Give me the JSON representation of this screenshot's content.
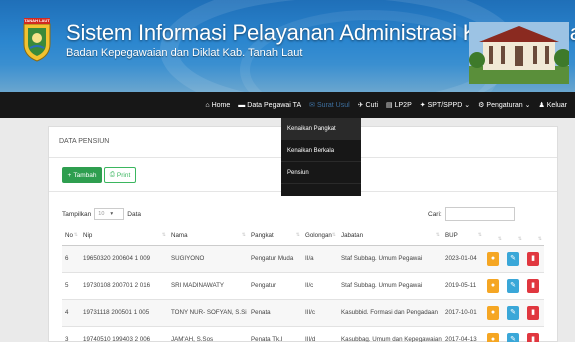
{
  "header": {
    "logo_tag": "TANAH LAUT",
    "title": "Sistem Informasi Pelayanan Administrasi Kepegawaian",
    "subtitle": "Badan Kepegawaian dan Diklat Kab. Tanah Laut"
  },
  "nav": {
    "items": [
      {
        "label": "Home",
        "icon": "home-icon",
        "glyph": "⌂"
      },
      {
        "label": "Data Pegawai TA",
        "icon": "folder-icon",
        "glyph": "▬"
      },
      {
        "label": "Surat Usul",
        "icon": "mail-icon",
        "glyph": "✉"
      },
      {
        "label": "Cuti",
        "icon": "plane-icon",
        "glyph": "✈"
      },
      {
        "label": "LP2P",
        "icon": "document-icon",
        "glyph": "▤"
      },
      {
        "label": "SPT/SPPD",
        "icon": "truck-icon",
        "glyph": "✦"
      },
      {
        "label": "Pengaturan",
        "icon": "gear-icon",
        "glyph": "⚙"
      },
      {
        "label": "Keluar",
        "icon": "user-icon",
        "glyph": "♟"
      }
    ]
  },
  "dropdown": {
    "items": [
      "Kenaikan Pangkat",
      "Kenaikan Berkala",
      "Pensiun"
    ]
  },
  "panel": {
    "title": "DATA PENSIUN",
    "add_label": "Tambah",
    "print_label": "Print",
    "show_label": "Tampilkan",
    "show_value": "10",
    "show_suffix": "Data",
    "search_label": "Cari:"
  },
  "table": {
    "headers": [
      "No",
      "Nip",
      "Nama",
      "Pangkat",
      "Golongan",
      "Jabatan",
      "BUP"
    ],
    "rows": [
      [
        "6",
        "19650320 200604 1 009",
        "SUGIYONO",
        "Pengatur Muda",
        "II/a",
        "Staf Subbag. Umum Pegawai",
        "2023-01-04"
      ],
      [
        "5",
        "19730108 200701 2 016",
        "SRI MADINAWATY",
        "Pengatur",
        "II/c",
        "Staf Subbag. Umum Pegawai",
        "2019-05-11"
      ],
      [
        "4",
        "19731118 200501 1 005",
        "TONY NUR- SOFYAN, S.Si",
        "Penata",
        "III/c",
        "Kasubbid. Formasi dan Pengadaan",
        "2017-10-01"
      ],
      [
        "3",
        "19740510 199403 2 006",
        "JAM'AH, S.Sos",
        "Penata Tk.I",
        "III/d",
        "Kasubbag. Umum dan Kepegawaian",
        "2017-04-13"
      ]
    ]
  },
  "colors": {
    "header_blue": "#2b86cf",
    "navbar": "#171717",
    "add_green": "#2e9e4f",
    "action_yellow": "#f5a623",
    "action_blue": "#3aa7d8",
    "action_red": "#e0373f"
  }
}
